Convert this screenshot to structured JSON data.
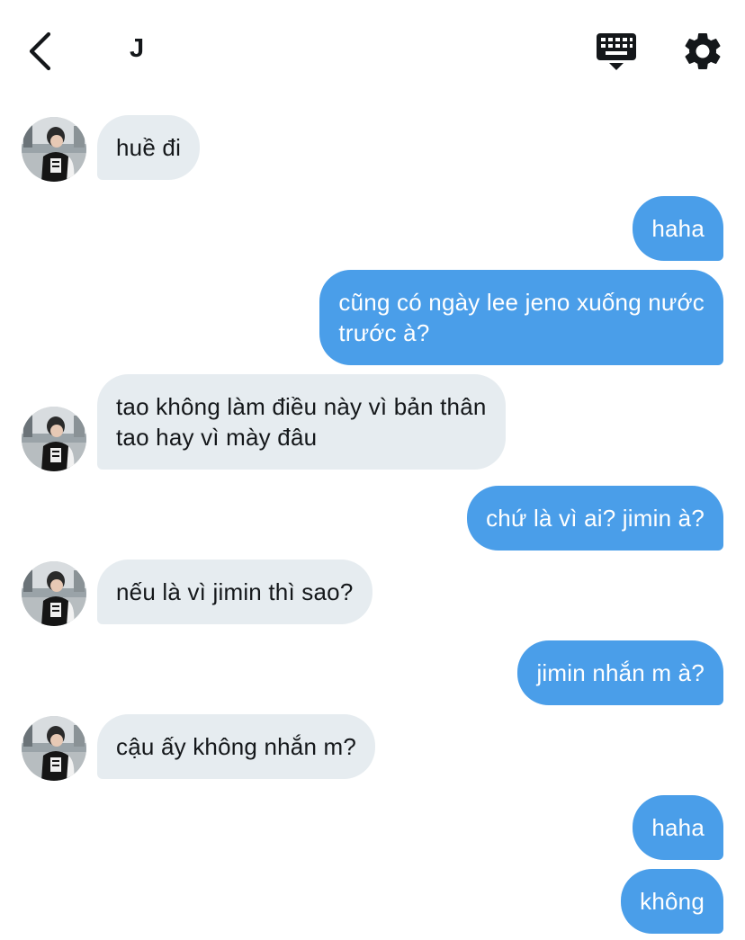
{
  "header": {
    "title": "J",
    "back_icon": "chevron-left-icon",
    "keyboard_icon": "keyboard-icon",
    "settings_icon": "gear-icon"
  },
  "colors": {
    "outgoing_bubble": "#4a9ee9",
    "incoming_bubble": "#e6ecf0",
    "text_dark": "#14171a"
  },
  "messages": [
    {
      "from": "them",
      "text": "huề đi"
    },
    {
      "from": "me",
      "text": "haha"
    },
    {
      "from": "me",
      "text": "cũng có ngày lee jeno xuống nước\ntrước à?"
    },
    {
      "from": "them",
      "text": "tao không làm điều này vì bản thân\ntao hay vì mày đâu"
    },
    {
      "from": "me",
      "text": "chứ là vì ai? jimin à?"
    },
    {
      "from": "them",
      "text": "nếu là vì jimin thì sao?"
    },
    {
      "from": "me",
      "text": "jimin nhắn m à?"
    },
    {
      "from": "them",
      "text": "cậu ấy không nhắn m?"
    },
    {
      "from": "me",
      "text": "haha"
    },
    {
      "from": "me",
      "text": "không"
    }
  ]
}
